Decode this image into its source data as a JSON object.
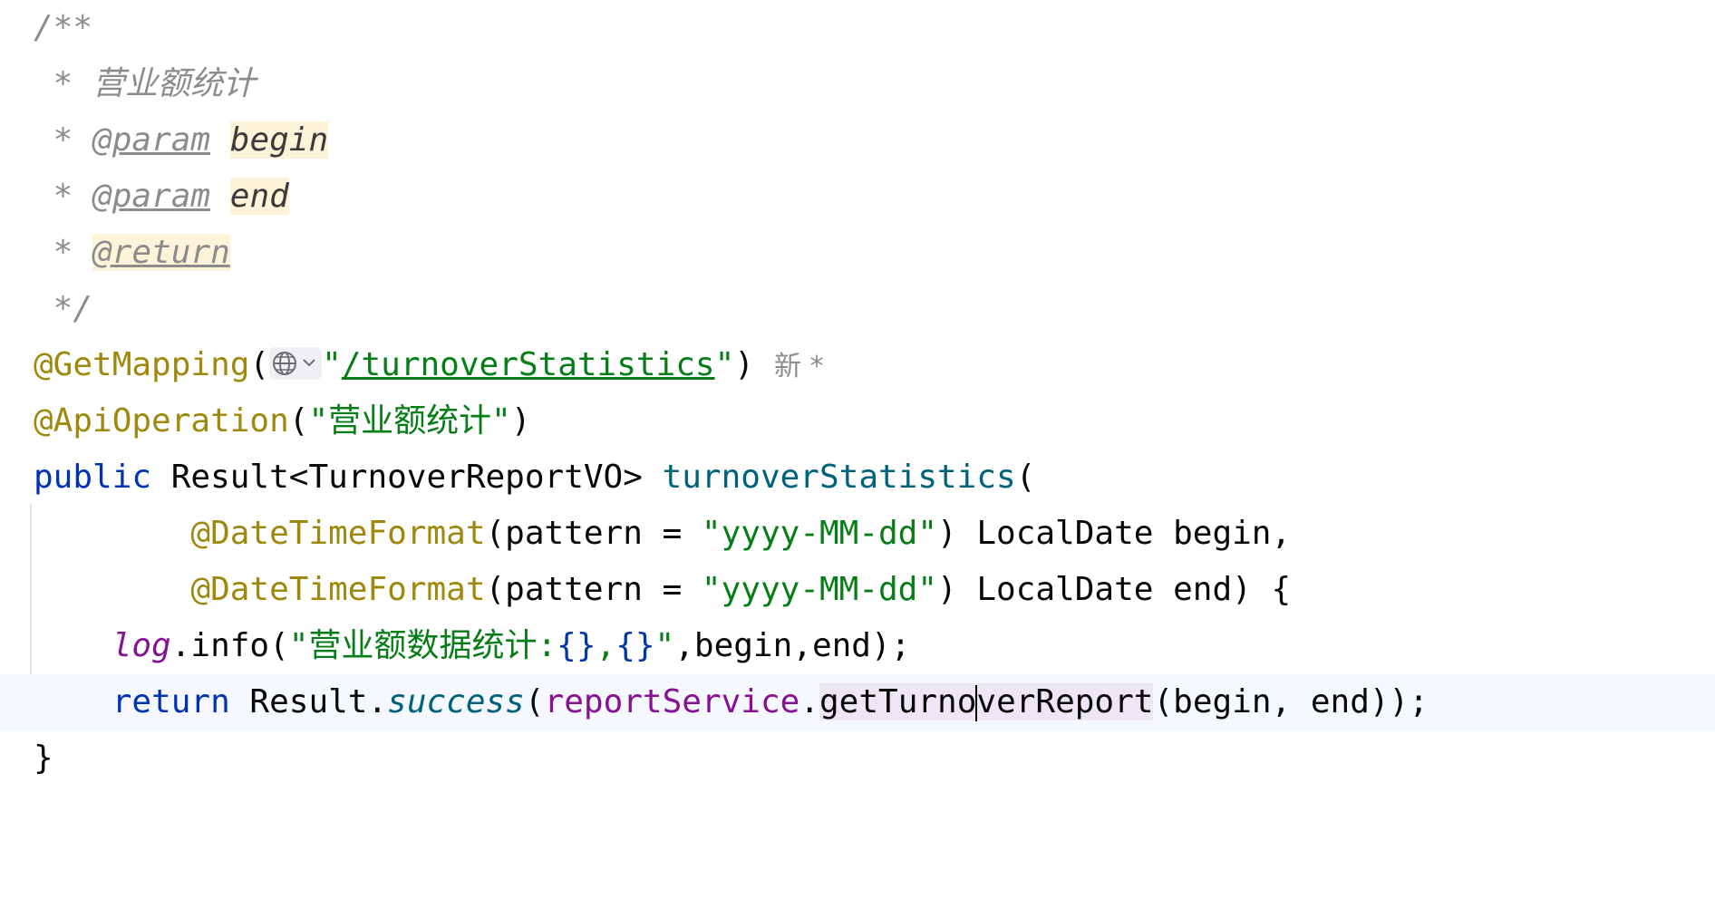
{
  "editor": {
    "doc_open": "/**",
    "doc_star": " *",
    "doc_summary": "营业额统计",
    "param_tag": "@param",
    "param1_name": "begin",
    "param2_name": "end",
    "return_tag": "@return",
    "doc_close": " */",
    "anno_get": "@GetMapping",
    "paren_open": "(",
    "paren_close": ")",
    "url_quote": "\"",
    "url_path": "/turnoverStatistics",
    "inlay_hint": "新 *",
    "anno_api": "@ApiOperation",
    "api_string": "\"营业额统计\"",
    "kw_public": "public",
    "return_type": " Result<TurnoverReportVO> ",
    "method_name": "turnoverStatistics",
    "anno_dtf": "@DateTimeFormat",
    "pattern_prefix": "(pattern = ",
    "pattern_value": "\"yyyy-MM-dd\"",
    "param1_rest": ") LocalDate begin,",
    "param2_rest": ") LocalDate end) {",
    "log_field": "log",
    "log_call": ".info(",
    "log_str_a": "\"营业额数据统计:",
    "log_braces_a": "{}",
    "log_comma": ",",
    "log_braces_b": "{}",
    "log_str_end": "\"",
    "log_args": ",begin,end);",
    "kw_return": "return",
    "result_cls": " Result.",
    "success_call": "success",
    "report_service": "reportService",
    "dot": ".",
    "get_turnover_a": "getTurno",
    "get_turnover_b": "verReport",
    "return_args": "(begin, end));",
    "closing_brace": "}"
  },
  "colors": {
    "background": "#ffffff",
    "comment": "#8c8c8c",
    "annotation": "#9e880d",
    "string": "#067d17",
    "keyword": "#0033b3",
    "method_declaration": "#00627a",
    "field": "#871094",
    "doc_highlight": "#fcf3d9",
    "usage_highlight": "#ede6f7",
    "current_line": "#f5f8fe"
  },
  "icons": {
    "endpoint_widget": "globe-icon",
    "endpoint_dropdown": "chevron-down-icon"
  }
}
